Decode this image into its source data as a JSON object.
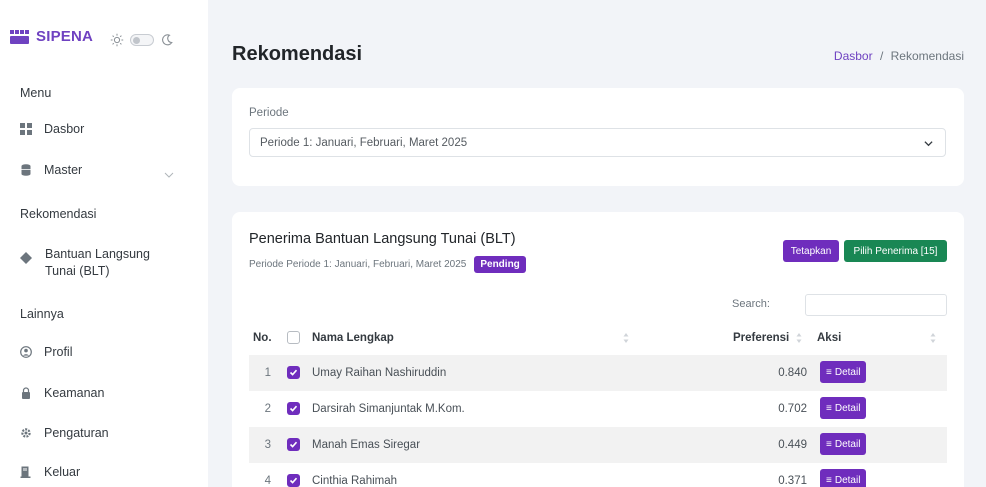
{
  "app": {
    "name": "SIPENA",
    "brand_color": "#6f42c1"
  },
  "sidebar": {
    "sections": [
      {
        "label": "Menu"
      },
      {
        "label": "Rekomendasi"
      },
      {
        "label": "Lainnya"
      }
    ],
    "items": [
      {
        "label": "Dasbor",
        "icon": "grid-icon"
      },
      {
        "label": "Master",
        "icon": "database-icon",
        "has_submenu": true
      },
      {
        "label": "Bantuan Langsung",
        "label2": "Tunai (BLT)",
        "icon": "diamond-icon"
      },
      {
        "label": "Profil",
        "icon": "user-circle-icon"
      },
      {
        "label": "Keamanan",
        "icon": "lock-icon"
      },
      {
        "label": "Pengaturan",
        "icon": "gear-icon"
      },
      {
        "label": "Keluar",
        "icon": "logout-icon"
      }
    ]
  },
  "header": {
    "title": "Rekomendasi",
    "breadcrumb": {
      "home": "Dasbor",
      "separator": "/",
      "current": "Rekomendasi"
    }
  },
  "periode_card": {
    "label": "Periode",
    "selected": "Periode 1: Januari, Februari, Maret 2025"
  },
  "table_card": {
    "title": "Penerima Bantuan Langsung Tunai (BLT)",
    "subtitle": "Periode Periode 1: Januari, Februari, Maret 2025",
    "status_badge": "Pending",
    "btn_tetapkan": "Tetapkan",
    "btn_pilih": "Pilih Penerima [15]",
    "search_label": "Search:",
    "columns": {
      "no": "No.",
      "name": "Nama Lengkap",
      "pref": "Preferensi",
      "aksi": "Aksi"
    },
    "detail_label": "Detail",
    "rows": [
      {
        "no": "1",
        "name": "Umay Raihan Nashiruddin",
        "pref": "0.840",
        "checked": true
      },
      {
        "no": "2",
        "name": "Darsirah Simanjuntak M.Kom.",
        "pref": "0.702",
        "checked": true
      },
      {
        "no": "3",
        "name": "Manah Emas Siregar",
        "pref": "0.449",
        "checked": true
      },
      {
        "no": "4",
        "name": "Cinthia Rahimah",
        "pref": "0.371",
        "checked": true
      }
    ]
  },
  "colors": {
    "primary": "#6f2dbd",
    "success": "#198754",
    "background": "#f2f4f8"
  }
}
